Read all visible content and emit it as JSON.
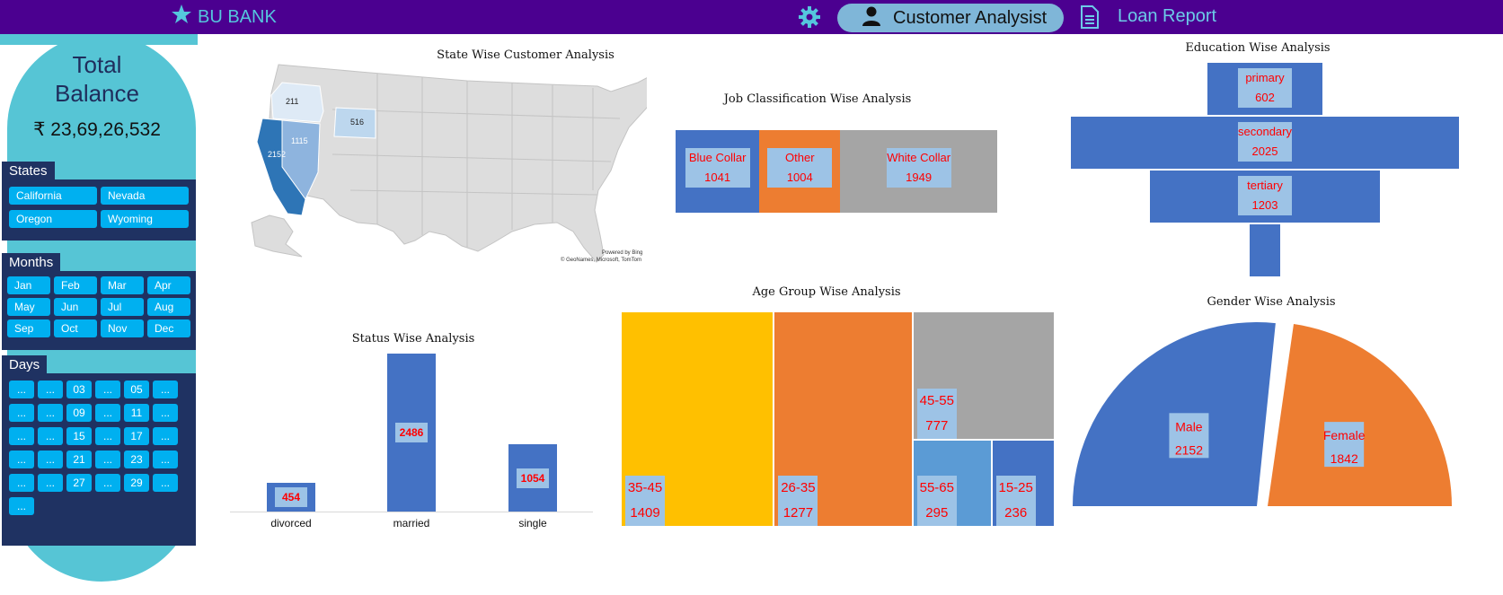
{
  "header": {
    "brand": "BU BANK",
    "tab_active": "Customer Analysist",
    "tab_other": "Loan Report"
  },
  "sidebar": {
    "total_title_line1": "Total",
    "total_title_line2": "Balance",
    "total_value": "₹ 23,69,26,532",
    "states_label": "States",
    "states": [
      "California",
      "Nevada",
      "Oregon",
      "Wyoming"
    ],
    "months_label": "Months",
    "months": [
      "Jan",
      "Feb",
      "Mar",
      "Apr",
      "May",
      "Jun",
      "Jul",
      "Aug",
      "Sep",
      "Oct",
      "Nov",
      "Dec"
    ],
    "days_label": "Days",
    "days": [
      "...",
      "...",
      "03",
      "...",
      "05",
      "...",
      "...",
      "...",
      "09",
      "...",
      "11",
      "...",
      "...",
      "...",
      "15",
      "...",
      "17",
      "...",
      "...",
      "...",
      "21",
      "...",
      "23",
      "...",
      "...",
      "...",
      "27",
      "...",
      "29",
      "...",
      "..."
    ]
  },
  "map": {
    "title": "State Wise Customer Analysis",
    "values": {
      "oregon": "211",
      "wyoming": "516",
      "nevada": "1115",
      "california": "2152"
    },
    "credit1": "Powered by Bing",
    "credit2": "© GeoNames, Microsoft, TomTom"
  },
  "chart_data": [
    {
      "type": "bar",
      "title": "Job Classification Wise Analysis",
      "categories": [
        "Blue Collar",
        "Other",
        "White Collar"
      ],
      "values": [
        1041,
        1004,
        1949
      ]
    },
    {
      "type": "bar",
      "title": "Education Wise Analysis",
      "categories": [
        "primary",
        "secondary",
        "tertiary",
        ""
      ],
      "values": [
        602,
        2025,
        1203,
        null
      ]
    },
    {
      "type": "bar",
      "title": "Status Wise Analysis",
      "categories": [
        "divorced",
        "married",
        "single"
      ],
      "values": [
        454,
        2486,
        1054
      ]
    },
    {
      "type": "heatmap",
      "title": "Age Group Wise Analysis",
      "categories": [
        "35-45",
        "26-35",
        "45-55",
        "55-65",
        "15-25"
      ],
      "values": [
        1409,
        1277,
        777,
        295,
        236
      ]
    },
    {
      "type": "pie",
      "title": "Gender Wise Analysis",
      "categories": [
        "Male",
        "Female"
      ],
      "values": [
        2152,
        1842
      ]
    }
  ],
  "colors": {
    "blue": "#4472c4",
    "orange": "#ed7d31",
    "gray": "#a5a5a5",
    "yellow": "#ffc000",
    "lightblue": "#5b9bd5",
    "purple": "#4b0090",
    "teal": "#56c5d5",
    "navy": "#1f3262",
    "cyan": "#00b0f0"
  },
  "icons": {
    "brand": "star-icon",
    "settings": "gear-icon",
    "user": "user-icon",
    "report": "document-icon"
  }
}
